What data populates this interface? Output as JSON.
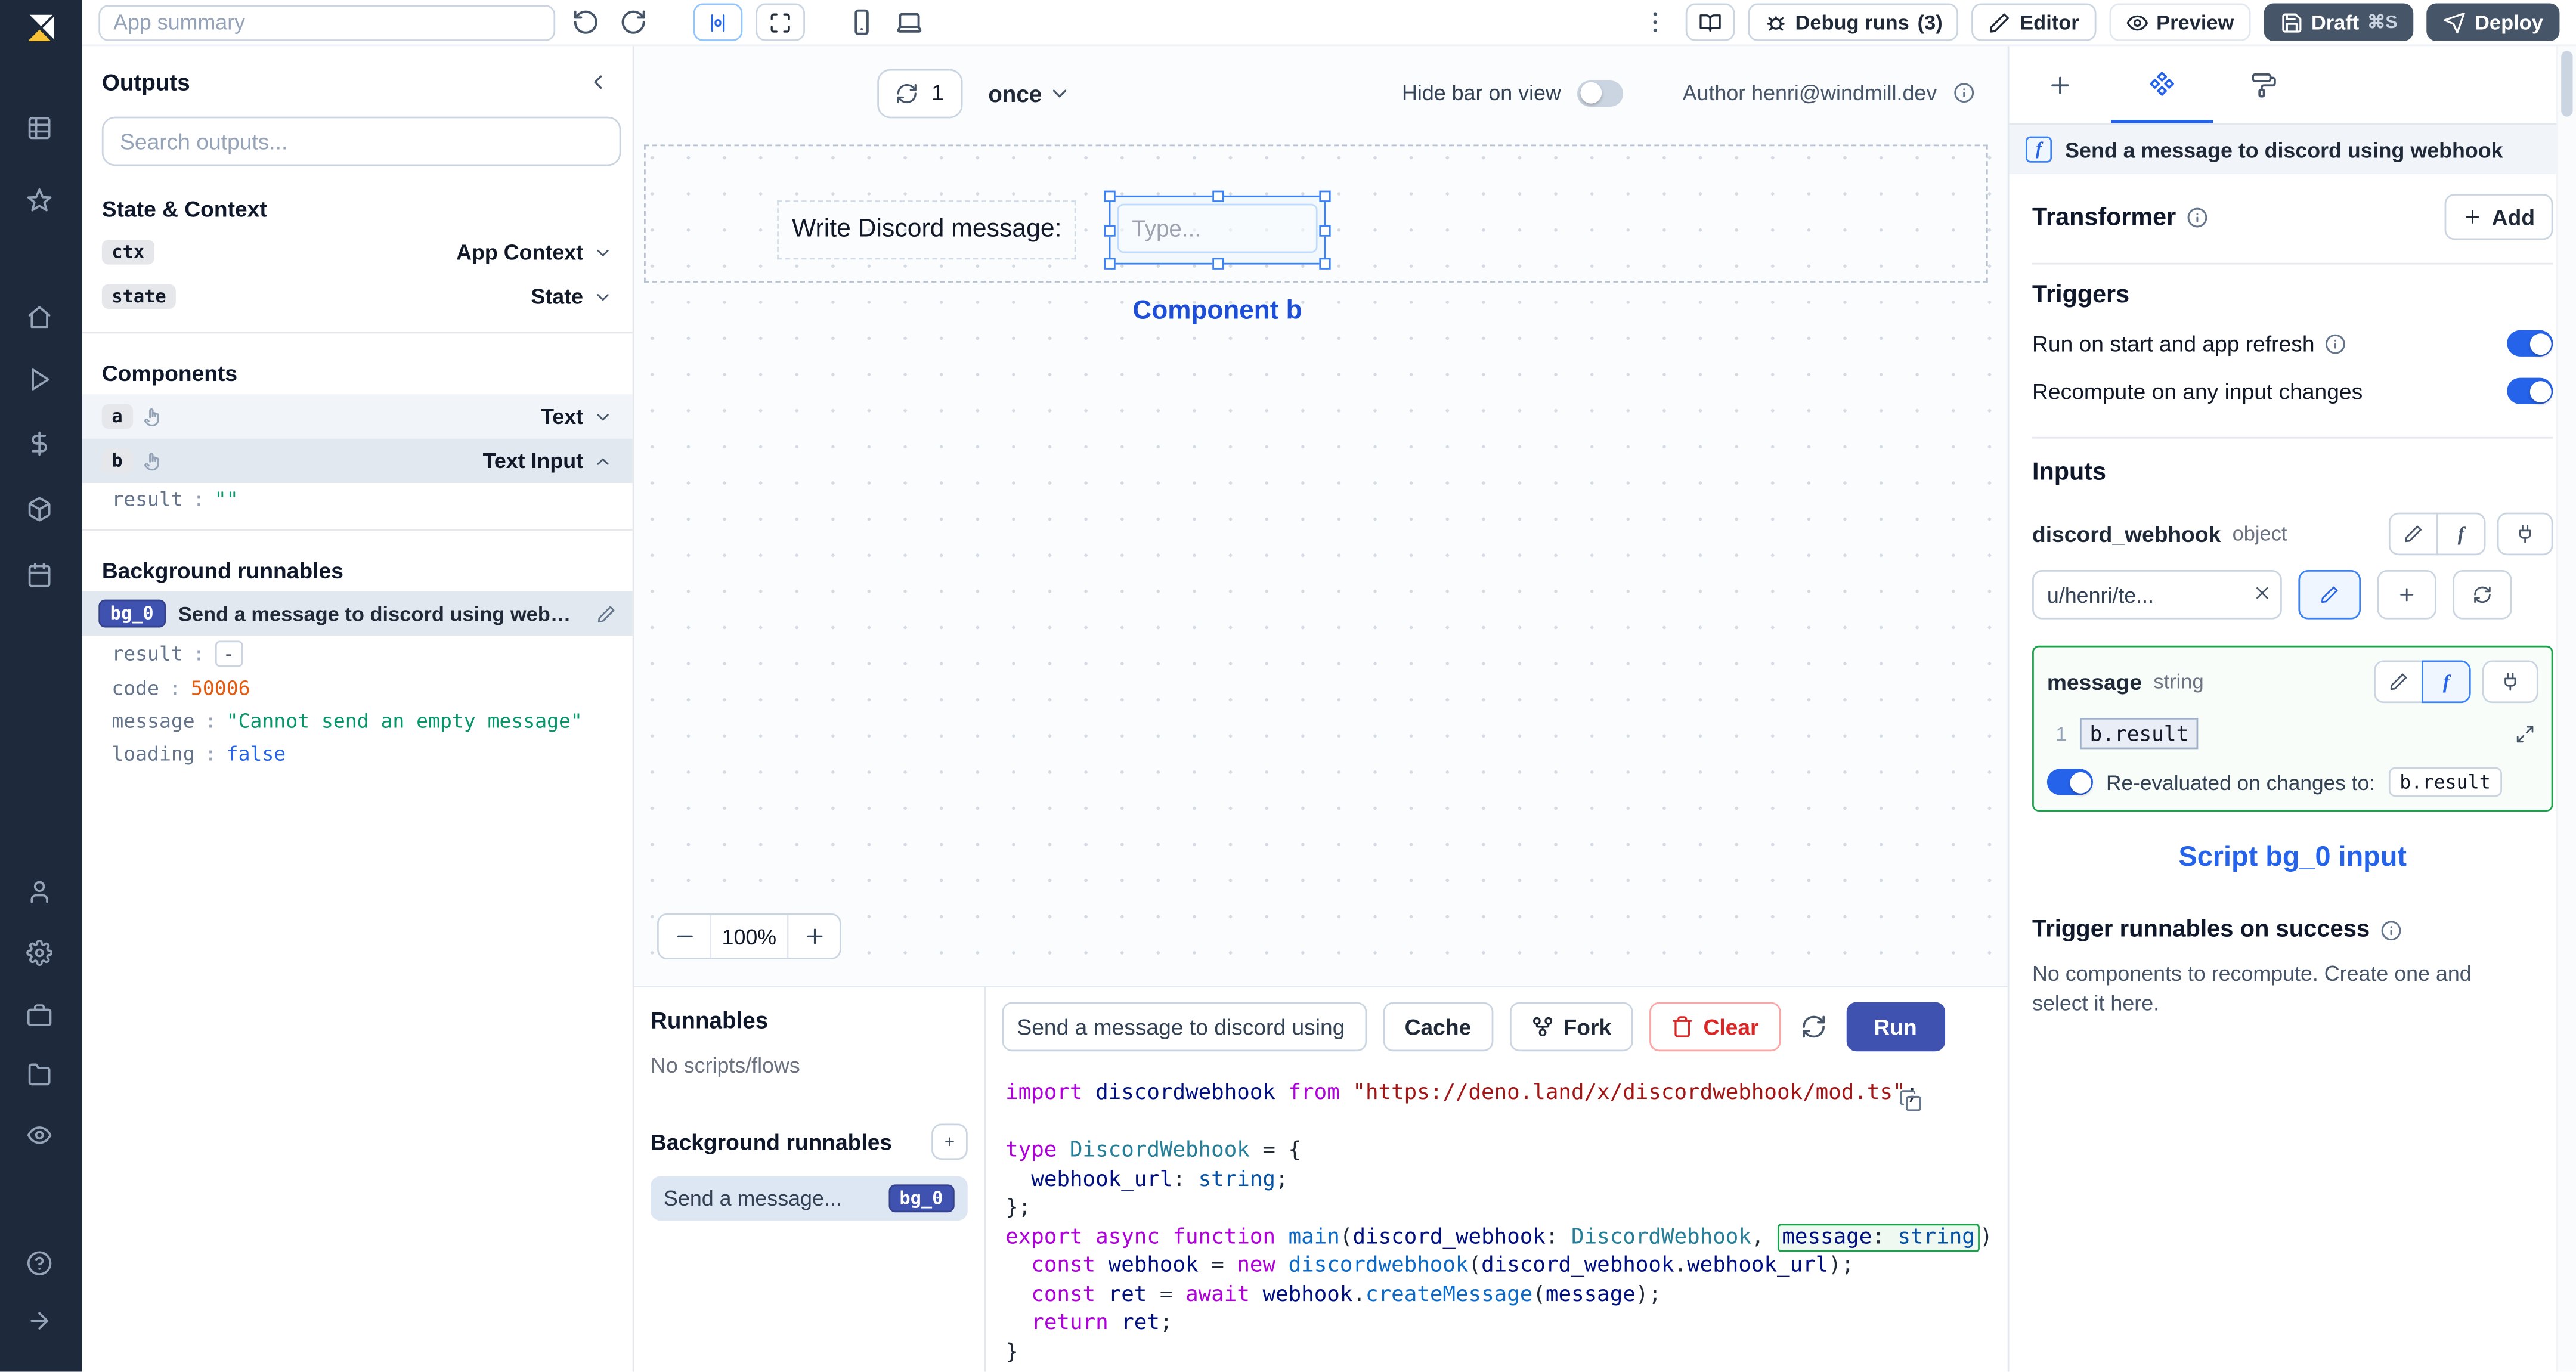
{
  "colors": {
    "accent": "#2563eb",
    "primary_button": "#4052b0",
    "success_border": "#16a34a",
    "danger": "#dc2626",
    "sidebar_bg": "#1e293b"
  },
  "topbar": {
    "app_summary_placeholder": "App summary",
    "debug_runs_label": "Debug runs",
    "debug_runs_count": "(3)",
    "editor_label": "Editor",
    "preview_label": "Preview",
    "draft_label": "Draft",
    "draft_shortcut": "⌘S",
    "deploy_label": "Deploy"
  },
  "outputs": {
    "title": "Outputs",
    "search_placeholder": "Search outputs...",
    "state_context_title": "State & Context",
    "rows": {
      "ctx": {
        "badge": "ctx",
        "label": "App Context"
      },
      "state": {
        "badge": "state",
        "label": "State"
      }
    },
    "components_title": "Components",
    "component_a": {
      "badge": "a",
      "label": "Text"
    },
    "component_b": {
      "badge": "b",
      "label": "Text Input",
      "result_key": "result",
      "result_value": "\"\""
    },
    "background_title": "Background runnables",
    "bg0": {
      "badge": "bg_0",
      "label": "Send a message to discord using webhook",
      "rows": [
        {
          "key": "result",
          "value": "-"
        },
        {
          "key": "code",
          "value": "50006"
        },
        {
          "key": "message",
          "value": "\"Cannot send an empty message\""
        },
        {
          "key": "loading",
          "value": "false"
        }
      ]
    }
  },
  "canvas": {
    "refresh_count": "1",
    "schedule_value": "once",
    "hide_bar_label": "Hide bar on view",
    "author_label": "Author henri@windmill.dev",
    "text_component": "Write Discord message:",
    "input_placeholder": "Type...",
    "selection_label": "Component b",
    "zoom_value": "100%"
  },
  "runnables": {
    "title": "Runnables",
    "empty_label": "No scripts/flows",
    "background_title": "Background runnables",
    "item": {
      "label": "Send a message...",
      "badge": "bg_0"
    }
  },
  "run_toolbar": {
    "name_value": "Send a message to discord using",
    "cache_label": "Cache",
    "fork_label": "Fork",
    "clear_label": "Clear",
    "run_label": "Run"
  },
  "code": {
    "lines": [
      [
        {
          "t": "import ",
          "c": "k"
        },
        {
          "t": "discordwebhook ",
          "c": "v"
        },
        {
          "t": "from ",
          "c": "k"
        },
        {
          "t": "\"https://deno.land/x/discordwebhook/mod.ts\"",
          "c": "s"
        },
        {
          "t": ";",
          "c": "p"
        }
      ],
      [],
      [
        {
          "t": "type ",
          "c": "k"
        },
        {
          "t": "DiscordWebhook",
          "c": "t"
        },
        {
          "t": " = {",
          "c": "p"
        }
      ],
      [
        {
          "t": "  ",
          "c": "p"
        },
        {
          "t": "webhook_url",
          "c": "v"
        },
        {
          "t": ": ",
          "c": "p"
        },
        {
          "t": "string",
          "c": "b"
        },
        {
          "t": ";",
          "c": "p"
        }
      ],
      [
        {
          "t": "};",
          "c": "p"
        }
      ],
      [
        {
          "t": "export ",
          "c": "k"
        },
        {
          "t": "async ",
          "c": "k"
        },
        {
          "t": "function ",
          "c": "k"
        },
        {
          "t": "main",
          "c": "f"
        },
        {
          "t": "(",
          "c": "p"
        },
        {
          "t": "discord_webhook",
          "c": "v"
        },
        {
          "t": ": ",
          "c": "p"
        },
        {
          "t": "DiscordWebhook",
          "c": "t"
        },
        {
          "t": ", ",
          "c": "p"
        },
        {
          "parts": [
            {
              "t": "message",
              "c": "v"
            },
            {
              "t": ": ",
              "c": "p"
            },
            {
              "t": "string",
              "c": "b"
            }
          ]
        },
        {
          "t": ") {",
          "c": "p"
        }
      ],
      [
        {
          "t": "  ",
          "c": "p"
        },
        {
          "t": "const ",
          "c": "k"
        },
        {
          "t": "webhook",
          "c": "v"
        },
        {
          "t": " = ",
          "c": "p"
        },
        {
          "t": "new ",
          "c": "k"
        },
        {
          "t": "discordwebhook",
          "c": "f"
        },
        {
          "t": "(",
          "c": "p"
        },
        {
          "t": "discord_webhook",
          "c": "v"
        },
        {
          "t": ".",
          "c": "p"
        },
        {
          "t": "webhook_url",
          "c": "v"
        },
        {
          "t": ");",
          "c": "p"
        }
      ],
      [
        {
          "t": "  ",
          "c": "p"
        },
        {
          "t": "const ",
          "c": "k"
        },
        {
          "t": "ret",
          "c": "v"
        },
        {
          "t": " = ",
          "c": "p"
        },
        {
          "t": "await ",
          "c": "k"
        },
        {
          "t": "webhook",
          "c": "v"
        },
        {
          "t": ".",
          "c": "p"
        },
        {
          "t": "createMessage",
          "c": "f"
        },
        {
          "t": "(",
          "c": "p"
        },
        {
          "t": "message",
          "c": "v"
        },
        {
          "t": ");",
          "c": "p"
        }
      ],
      [
        {
          "t": "  ",
          "c": "p"
        },
        {
          "t": "return ",
          "c": "k"
        },
        {
          "t": "ret",
          "c": "v"
        },
        {
          "t": ";",
          "c": "p"
        }
      ],
      [
        {
          "t": "}",
          "c": "p"
        }
      ]
    ]
  },
  "settings": {
    "header_title": "Send a message to discord using webhook",
    "transformer_label": "Transformer",
    "add_label": "Add",
    "triggers_title": "Triggers",
    "trigger_rows": [
      {
        "label": "Run on start and app refresh"
      },
      {
        "label": "Recompute on any input changes"
      }
    ],
    "inputs_title": "Inputs",
    "discord_webhook": {
      "name": "discord_webhook",
      "type": "object",
      "value": "u/henri/te..."
    },
    "message": {
      "name": "message",
      "type": "string",
      "line_number": "1",
      "expression": "b.result",
      "reeval_label": "Re-evaluated on changes to:",
      "reeval_value": "b.result"
    },
    "annotation": "Script bg_0 input",
    "success_title": "Trigger runnables on success",
    "success_empty": "No components to recompute. Create one and select it here."
  }
}
